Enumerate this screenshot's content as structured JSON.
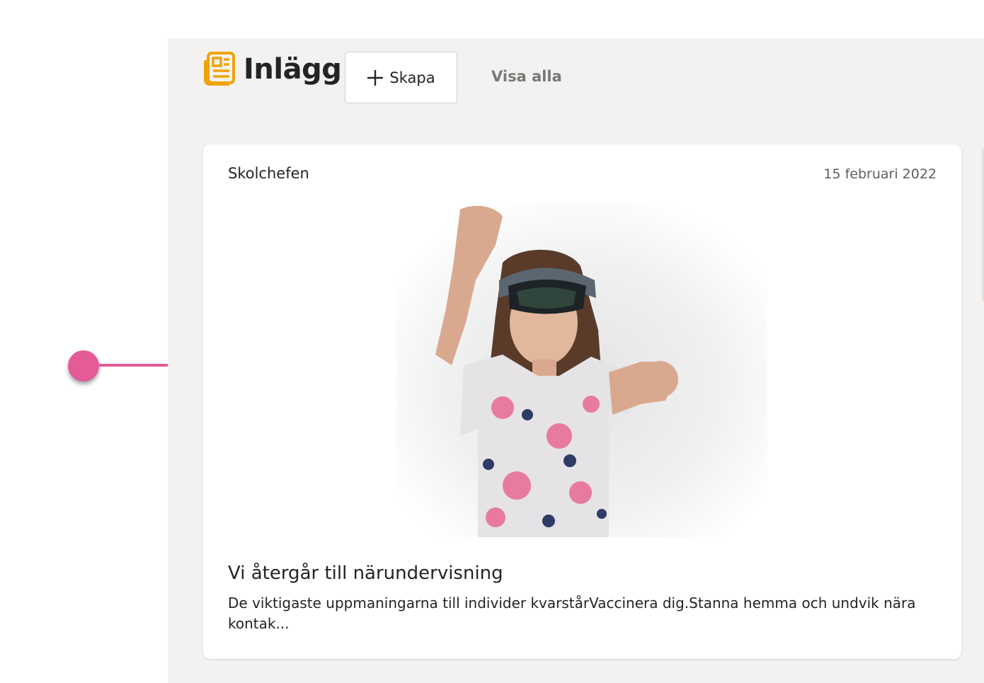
{
  "header": {
    "icon": "news-icon",
    "title": "Inlägg",
    "create_label": "Skapa",
    "show_all_label": "Visa alla"
  },
  "colors": {
    "accent_orange": "#f0a30a",
    "marker_pink": "#e45b98",
    "panel_bg": "#f3f2f1"
  },
  "post": {
    "author": "Skolchefen",
    "date": "15 februari 2022",
    "image_icon": "post-photo-vr-headset-girl",
    "title": "Vi återgår till närundervisning",
    "excerpt": "De viktigaste uppmaningarna till individer kvarstårVaccinera dig.Stanna hemma och undvik nära kontak..."
  }
}
